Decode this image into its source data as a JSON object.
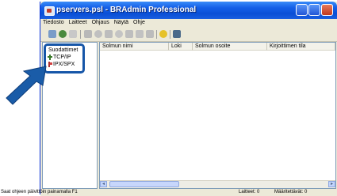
{
  "window": {
    "title": "pservers.psl - BRAdmin Professional"
  },
  "menu": [
    "Tiedosto",
    "Laitteet",
    "Ohjaus",
    "Näytä",
    "Ohje"
  ],
  "toolbar": {
    "icons": [
      "search-icon",
      "refresh-icon",
      "print-icon",
      "device-icon",
      "settings-icon",
      "sync-icon",
      "network-icon",
      "send-icon",
      "table-icon",
      "print-queue-icon",
      "help-icon",
      "monitor-icon"
    ]
  },
  "filters": {
    "title": "Suodattimet",
    "items": [
      "TCP/IP",
      "IPX/SPX"
    ]
  },
  "list": {
    "columns": [
      "Solmun nimi",
      "Loki",
      "Solmun osoite",
      "Kirjoittimen tila"
    ]
  },
  "status": {
    "hint": "Saat ohjeen päivittöin painamalla F1",
    "devices": "Laitteet: 0",
    "configured": "Määritettävät: 0"
  },
  "colors": {
    "titlebar": "#0a4fd6",
    "highlight_border": "#1656a8",
    "arrow": "#1a5ca8"
  }
}
